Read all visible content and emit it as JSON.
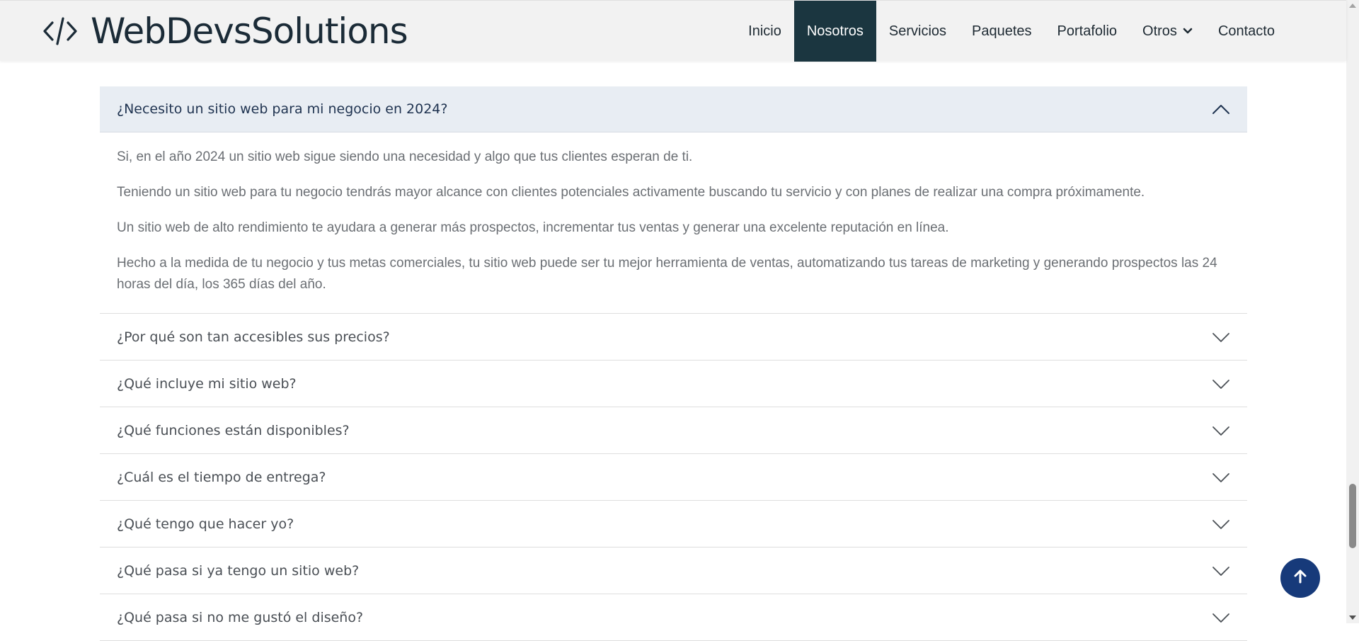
{
  "header": {
    "logo_text": "WebDevsSolutions",
    "logo_icon": "code-brackets-icon",
    "nav": [
      {
        "label": "Inicio",
        "active": false
      },
      {
        "label": "Nosotros",
        "active": true
      },
      {
        "label": "Servicios",
        "active": false
      },
      {
        "label": "Paquetes",
        "active": false
      },
      {
        "label": "Portafolio",
        "active": false
      },
      {
        "label": "Otros",
        "active": false,
        "has_dropdown": true
      },
      {
        "label": "Contacto",
        "active": false
      }
    ]
  },
  "faq": {
    "open_item": {
      "question": "¿Necesito un sitio web para mi negocio en 2024?",
      "answer": [
        "Si, en el año 2024 un sitio web sigue siendo una necesidad y algo que tus clientes esperan de ti.",
        "Teniendo un sitio web para tu negocio tendrás mayor alcance con clientes potenciales activamente buscando tu servicio y con planes de realizar una compra próximamente.",
        "Un sitio web de alto rendimiento te ayudara a generar más prospectos, incrementar tus ventas y generar una excelente reputación en línea.",
        "Hecho a la medida de tu negocio y tus metas comerciales, tu sitio web puede ser tu mejor herramienta de ventas, automatizando tus tareas de marketing y generando prospectos las 24 horas del día, los 365 días del año."
      ]
    },
    "items": [
      {
        "question": "¿Por qué son tan accesibles sus precios?"
      },
      {
        "question": "¿Qué incluye mi sitio web?"
      },
      {
        "question": "¿Qué funciones están disponibles?"
      },
      {
        "question": "¿Cuál es el tiempo de entrega?"
      },
      {
        "question": "¿Qué tengo que hacer yo?"
      },
      {
        "question": "¿Qué pasa si ya tengo un sitio web?"
      },
      {
        "question": "¿Qué pasa si no me gustó el diseño?"
      }
    ]
  },
  "colors": {
    "brand_dark": "#1b3640",
    "accent_blue": "#173a7a",
    "open_header_bg": "#e8edf3"
  },
  "back_to_top_icon": "arrow-up-icon"
}
